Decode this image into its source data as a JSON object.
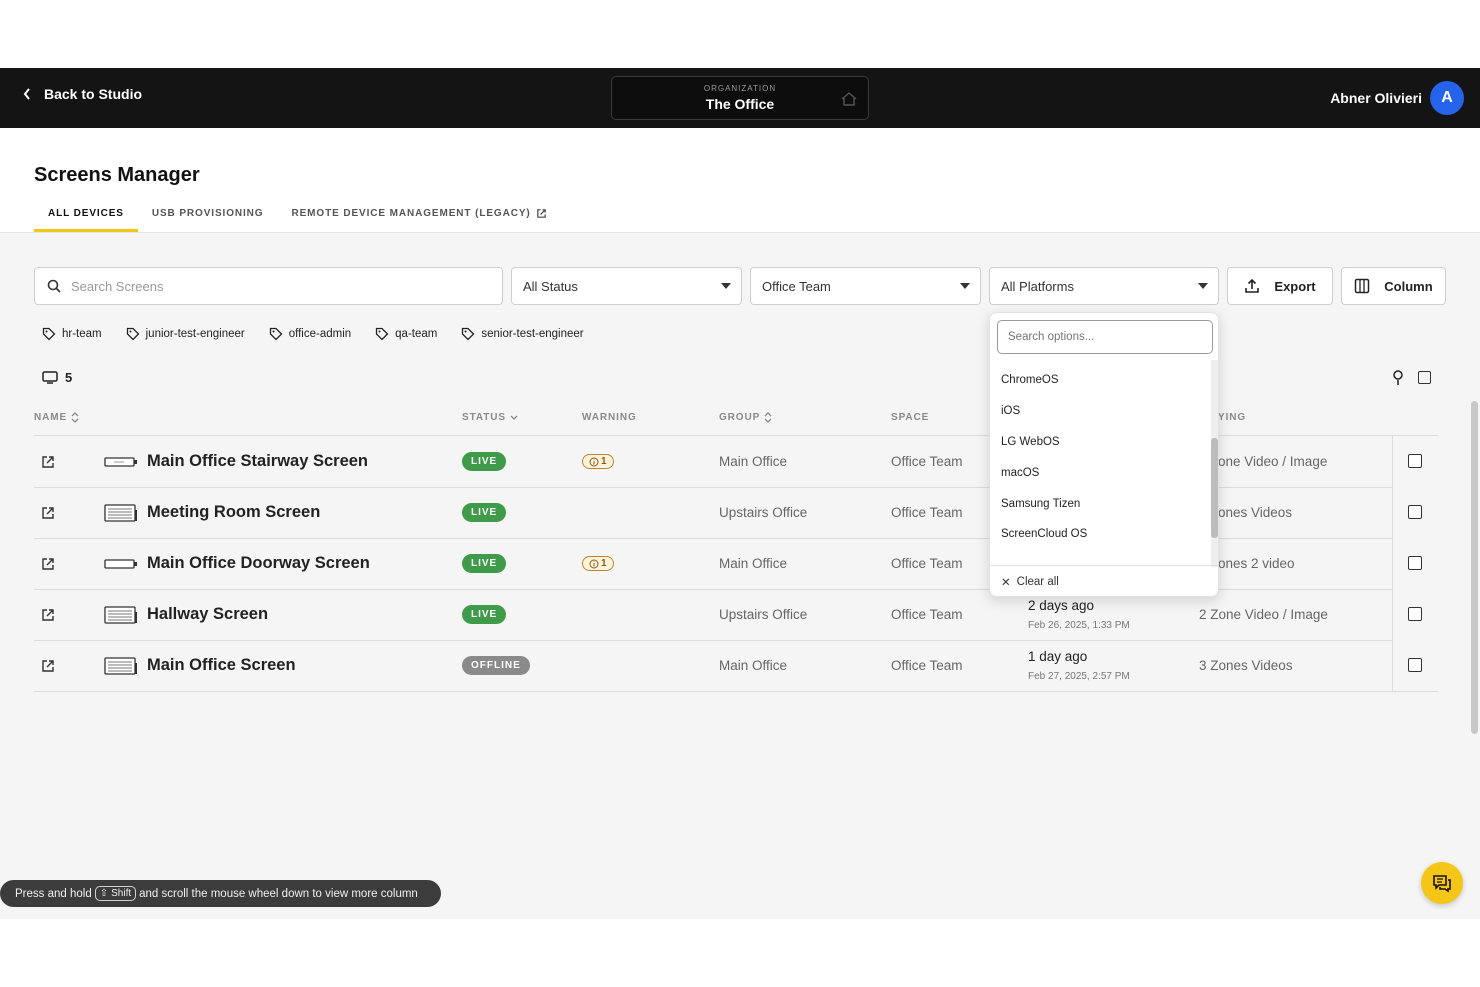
{
  "topbar": {
    "back_label": "Back to Studio",
    "org_label": "ORGANIZATION",
    "org_name": "The Office",
    "user_name": "Abner Olivieri",
    "avatar_initial": "A"
  },
  "page": {
    "title": "Screens Manager",
    "tabs": [
      {
        "label": "ALL DEVICES",
        "active": true
      },
      {
        "label": "USB PROVISIONING",
        "active": false
      },
      {
        "label": "REMOTE DEVICE MANAGEMENT (LEGACY)",
        "active": false
      }
    ]
  },
  "filters": {
    "search_placeholder": "Search Screens",
    "status": "All Status",
    "team": "Office Team",
    "platform": "All Platforms",
    "export_label": "Export",
    "column_label": "Column"
  },
  "tags": [
    "hr-team",
    "junior-test-engineer",
    "office-admin",
    "qa-team",
    "senior-test-engineer"
  ],
  "device_count": "5",
  "table": {
    "headers": {
      "name": "NAME",
      "status": "STATUS",
      "warning": "WARNING",
      "group": "GROUP",
      "space": "SPACE",
      "playing": "YING"
    },
    "rows": [
      {
        "name": "Main Office Stairway Screen",
        "status": "LIVE",
        "warning": "1",
        "group": "Main Office",
        "space": "Office Team",
        "last_seen": "",
        "last_seen_date": "",
        "playing": "one Video / Image",
        "device": "stick"
      },
      {
        "name": "Meeting Room Screen",
        "status": "LIVE",
        "warning": "",
        "group": "Upstairs Office",
        "space": "Office Team",
        "last_seen": "",
        "last_seen_date": "",
        "playing": "ones Videos",
        "device": "box"
      },
      {
        "name": "Main Office Doorway Screen",
        "status": "LIVE",
        "warning": "1",
        "group": "Main Office",
        "space": "Office Team",
        "last_seen": "",
        "last_seen_date": "",
        "playing": "ones 2 video",
        "device": "stick"
      },
      {
        "name": "Hallway Screen",
        "status": "LIVE",
        "warning": "",
        "group": "Upstairs Office",
        "space": "Office Team",
        "last_seen": "2 days ago",
        "last_seen_date": "Feb 26, 2025, 1:33 PM",
        "playing": "2 Zone Video / Image",
        "device": "box"
      },
      {
        "name": "Main Office Screen",
        "status": "OFFLINE",
        "warning": "",
        "group": "Main Office",
        "space": "Office Team",
        "last_seen": "1 day ago",
        "last_seen_date": "Feb 27, 2025, 2:57 PM",
        "playing": "3 Zones Videos",
        "device": "box"
      }
    ]
  },
  "platform_dropdown": {
    "search_placeholder": "Search options...",
    "options": [
      "ChromeOS",
      "iOS",
      "LG WebOS",
      "macOS",
      "Samsung Tizen",
      "ScreenCloud OS"
    ],
    "clear_label": "Clear all"
  },
  "hint": {
    "before": "Press and hold",
    "key": "Shift",
    "after": "and scroll the mouse wheel down to view more column"
  },
  "colors": {
    "accent": "#f5c518",
    "live": "#3f9b4a",
    "offline": "#8a8a8a",
    "avatar": "#2563eb",
    "topbar": "#141414"
  }
}
